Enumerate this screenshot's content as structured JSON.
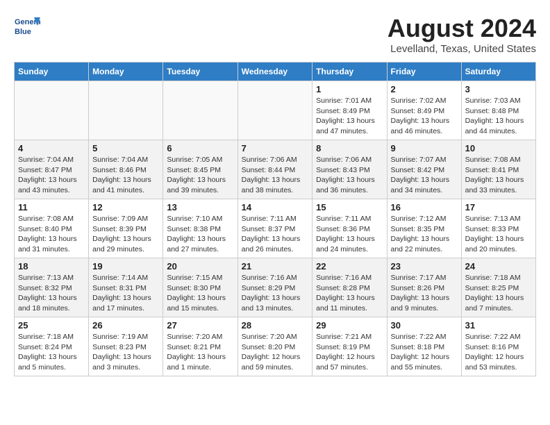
{
  "header": {
    "logo_line1": "General",
    "logo_line2": "Blue",
    "title": "August 2024",
    "subtitle": "Levelland, Texas, United States"
  },
  "days_of_week": [
    "Sunday",
    "Monday",
    "Tuesday",
    "Wednesday",
    "Thursday",
    "Friday",
    "Saturday"
  ],
  "weeks": [
    [
      {
        "day": "",
        "info": ""
      },
      {
        "day": "",
        "info": ""
      },
      {
        "day": "",
        "info": ""
      },
      {
        "day": "",
        "info": ""
      },
      {
        "day": "1",
        "info": "Sunrise: 7:01 AM\nSunset: 8:49 PM\nDaylight: 13 hours\nand 47 minutes."
      },
      {
        "day": "2",
        "info": "Sunrise: 7:02 AM\nSunset: 8:49 PM\nDaylight: 13 hours\nand 46 minutes."
      },
      {
        "day": "3",
        "info": "Sunrise: 7:03 AM\nSunset: 8:48 PM\nDaylight: 13 hours\nand 44 minutes."
      }
    ],
    [
      {
        "day": "4",
        "info": "Sunrise: 7:04 AM\nSunset: 8:47 PM\nDaylight: 13 hours\nand 43 minutes."
      },
      {
        "day": "5",
        "info": "Sunrise: 7:04 AM\nSunset: 8:46 PM\nDaylight: 13 hours\nand 41 minutes."
      },
      {
        "day": "6",
        "info": "Sunrise: 7:05 AM\nSunset: 8:45 PM\nDaylight: 13 hours\nand 39 minutes."
      },
      {
        "day": "7",
        "info": "Sunrise: 7:06 AM\nSunset: 8:44 PM\nDaylight: 13 hours\nand 38 minutes."
      },
      {
        "day": "8",
        "info": "Sunrise: 7:06 AM\nSunset: 8:43 PM\nDaylight: 13 hours\nand 36 minutes."
      },
      {
        "day": "9",
        "info": "Sunrise: 7:07 AM\nSunset: 8:42 PM\nDaylight: 13 hours\nand 34 minutes."
      },
      {
        "day": "10",
        "info": "Sunrise: 7:08 AM\nSunset: 8:41 PM\nDaylight: 13 hours\nand 33 minutes."
      }
    ],
    [
      {
        "day": "11",
        "info": "Sunrise: 7:08 AM\nSunset: 8:40 PM\nDaylight: 13 hours\nand 31 minutes."
      },
      {
        "day": "12",
        "info": "Sunrise: 7:09 AM\nSunset: 8:39 PM\nDaylight: 13 hours\nand 29 minutes."
      },
      {
        "day": "13",
        "info": "Sunrise: 7:10 AM\nSunset: 8:38 PM\nDaylight: 13 hours\nand 27 minutes."
      },
      {
        "day": "14",
        "info": "Sunrise: 7:11 AM\nSunset: 8:37 PM\nDaylight: 13 hours\nand 26 minutes."
      },
      {
        "day": "15",
        "info": "Sunrise: 7:11 AM\nSunset: 8:36 PM\nDaylight: 13 hours\nand 24 minutes."
      },
      {
        "day": "16",
        "info": "Sunrise: 7:12 AM\nSunset: 8:35 PM\nDaylight: 13 hours\nand 22 minutes."
      },
      {
        "day": "17",
        "info": "Sunrise: 7:13 AM\nSunset: 8:33 PM\nDaylight: 13 hours\nand 20 minutes."
      }
    ],
    [
      {
        "day": "18",
        "info": "Sunrise: 7:13 AM\nSunset: 8:32 PM\nDaylight: 13 hours\nand 18 minutes."
      },
      {
        "day": "19",
        "info": "Sunrise: 7:14 AM\nSunset: 8:31 PM\nDaylight: 13 hours\nand 17 minutes."
      },
      {
        "day": "20",
        "info": "Sunrise: 7:15 AM\nSunset: 8:30 PM\nDaylight: 13 hours\nand 15 minutes."
      },
      {
        "day": "21",
        "info": "Sunrise: 7:16 AM\nSunset: 8:29 PM\nDaylight: 13 hours\nand 13 minutes."
      },
      {
        "day": "22",
        "info": "Sunrise: 7:16 AM\nSunset: 8:28 PM\nDaylight: 13 hours\nand 11 minutes."
      },
      {
        "day": "23",
        "info": "Sunrise: 7:17 AM\nSunset: 8:26 PM\nDaylight: 13 hours\nand 9 minutes."
      },
      {
        "day": "24",
        "info": "Sunrise: 7:18 AM\nSunset: 8:25 PM\nDaylight: 13 hours\nand 7 minutes."
      }
    ],
    [
      {
        "day": "25",
        "info": "Sunrise: 7:18 AM\nSunset: 8:24 PM\nDaylight: 13 hours\nand 5 minutes."
      },
      {
        "day": "26",
        "info": "Sunrise: 7:19 AM\nSunset: 8:23 PM\nDaylight: 13 hours\nand 3 minutes."
      },
      {
        "day": "27",
        "info": "Sunrise: 7:20 AM\nSunset: 8:21 PM\nDaylight: 13 hours\nand 1 minute."
      },
      {
        "day": "28",
        "info": "Sunrise: 7:20 AM\nSunset: 8:20 PM\nDaylight: 12 hours\nand 59 minutes."
      },
      {
        "day": "29",
        "info": "Sunrise: 7:21 AM\nSunset: 8:19 PM\nDaylight: 12 hours\nand 57 minutes."
      },
      {
        "day": "30",
        "info": "Sunrise: 7:22 AM\nSunset: 8:18 PM\nDaylight: 12 hours\nand 55 minutes."
      },
      {
        "day": "31",
        "info": "Sunrise: 7:22 AM\nSunset: 8:16 PM\nDaylight: 12 hours\nand 53 minutes."
      }
    ]
  ]
}
